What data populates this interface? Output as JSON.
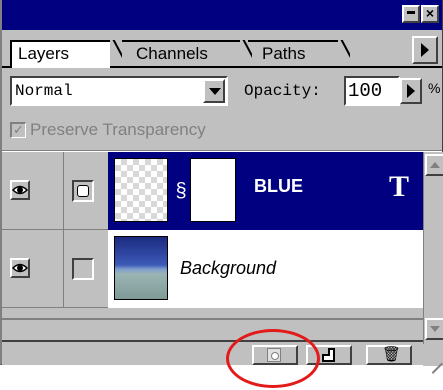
{
  "tabs": [
    {
      "label": "Layers",
      "active": true
    },
    {
      "label": "Channels",
      "active": false
    },
    {
      "label": "Paths",
      "active": false
    }
  ],
  "options": {
    "blend_mode": "Normal",
    "opacity_label": "Opacity:",
    "opacity_value": "100",
    "percent": "%"
  },
  "preserve_transparency": {
    "label": "Preserve Transparency",
    "checked": true,
    "enabled": false
  },
  "layers": [
    {
      "name": "BLUE",
      "selected": true,
      "visible": true,
      "type_icon": "T"
    },
    {
      "name": "Background",
      "selected": false,
      "visible": true
    }
  ],
  "bottom_toolbar": {
    "buttons": [
      "add-layer-mask-icon",
      "new-layer-icon",
      "trash-icon"
    ]
  },
  "colors": {
    "title_bar": "#000080",
    "selection": "#000080",
    "annotation": "#e31a1a",
    "chrome": "#c0c0c0"
  }
}
